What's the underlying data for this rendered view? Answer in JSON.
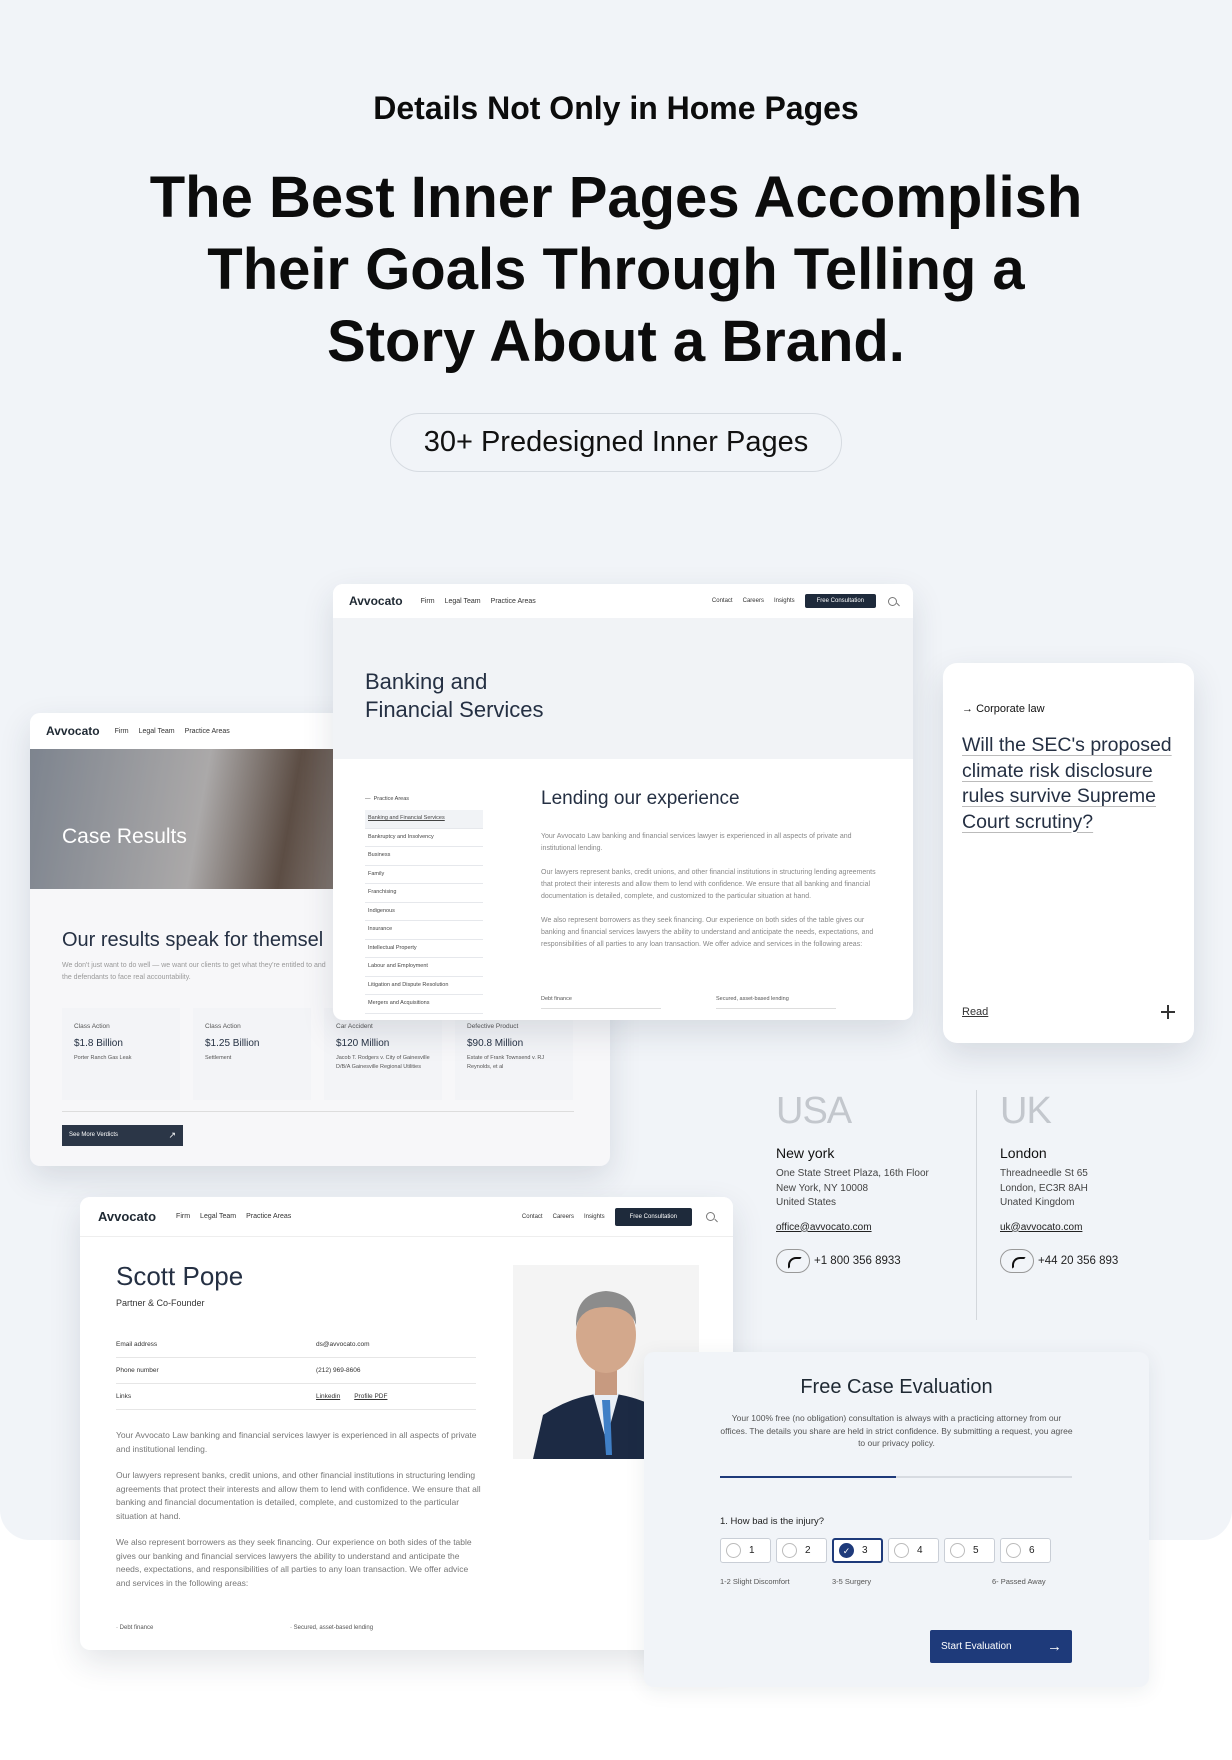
{
  "hero": {
    "kicker": "Details Not Only in Home Pages",
    "headline_line1": "The Best Inner Pages Accomplish",
    "headline_line2": "Their Goals Through Telling a",
    "headline_line3": "Story About a Brand.",
    "pill": "30+ Predesigned Inner Pages"
  },
  "nav": {
    "logo": "Avvocato",
    "firm": "Firm",
    "legal_team": "Legal Team",
    "practice_areas": "Practice Areas",
    "contact": "Contact",
    "careers": "Careers",
    "insights": "Insights",
    "cta": "Free Consultation"
  },
  "case_results": {
    "hero_title": "Case Results",
    "heading": "Our results speak for themsel",
    "intro": "We don't just want to do well — we want our clients to get what they're entitled to and the defendants to face real accountability.",
    "stats": [
      {
        "category": "Class Action",
        "value": "$1.8 Billion",
        "desc": "Porter Ranch Gas Leak"
      },
      {
        "category": "Class Action",
        "value": "$1.25 Billion",
        "desc": "Settlement"
      },
      {
        "category": "Car Accident",
        "value": "$120 Million",
        "desc": "Jacob T. Rodgers v. City of Gainesville D/B/A Gainesville Regional Utilities"
      },
      {
        "category": "Defective Product",
        "value": "$90.8 Million",
        "desc": "Estate of Frank Townsend v. RJ Reynolds, et al"
      }
    ],
    "button": "See More Verdicts"
  },
  "banking": {
    "title_line1": "Banking and",
    "title_line2": "Financial Services",
    "sidebar_heading": "Practice Areas",
    "sidebar_items": [
      "Banking and Financial Services",
      "Bankruptcy and Insolvency",
      "Business",
      "Family",
      "Franchising",
      "Indigenous",
      "Insurance",
      "Intellectual Property",
      "Labour and Employment",
      "Litigation and Dispute Resolution",
      "Mergers and Acquisitions"
    ],
    "section_title": "Lending our experience",
    "p1": "Your Avvocato Law banking and financial services lawyer is experienced in all aspects of private and institutional lending.",
    "p2": "Our lawyers represent banks, credit unions, and other financial institutions in structuring lending agreements that protect their interests and allow them to lend with confidence. We ensure that all banking and financial documentation is detailed, complete, and customized to the particular situation at hand.",
    "p3": "We also represent borrowers as they seek financing. Our experience on both sides of the table gives our banking and financial services lawyers the ability to understand and anticipate the needs, expectations, and responsibilities of all parties to any loan transaction. We offer advice and services in the following areas:",
    "list_left": "Debt finance",
    "list_right": "Secured, asset-based lending"
  },
  "article": {
    "category": "Corporate law",
    "title": "Will the SEC's proposed climate risk disclosure rules survive Supreme Court scrutiny?",
    "read": "Read"
  },
  "offices": [
    {
      "country": "USA",
      "city": "New york",
      "addr1": "One State Street Plaza, 16th Floor",
      "addr2": "New York, NY 10008",
      "addr3": "United States",
      "email": "office@avvocato.com",
      "phone": "+1 800 356 8933"
    },
    {
      "country": "UK",
      "city": "London",
      "addr1": "Threadneedle St 65",
      "addr2": "London, EC3R 8AH",
      "addr3": "Unated Kingdom",
      "email": "uk@avvocato.com",
      "phone": "+44 20 356 893"
    }
  ],
  "profile": {
    "name": "Scott Pope",
    "role": "Partner & Co-Founder",
    "rows": [
      {
        "label": "Email address",
        "value": "ds@avvocato.com"
      },
      {
        "label": "Phone number",
        "value": "(212) 969-8606"
      },
      {
        "label": "Links",
        "value": "Linkedin",
        "value2": "Profile PDF"
      }
    ],
    "p1": "Your Avvocato Law banking and financial services lawyer is experienced in all aspects of private and institutional lending.",
    "p2": "Our lawyers represent banks, credit unions, and other financial institutions in structuring lending agreements that protect their interests and allow them to lend with confidence. We ensure that all banking and financial documentation is detailed, complete, and customized to the particular situation at hand.",
    "p3": "We also represent borrowers as they seek financing. Our experience on both sides of the table gives our banking and financial services lawyers the ability to understand and anticipate the needs, expectations, and responsibilities of all parties to any loan transaction. We offer advice and services in the following areas:",
    "list_left": "Debt finance",
    "list_right": "Secured, asset-based lending"
  },
  "evaluation": {
    "title": "Free Case Evaluation",
    "description": "Your 100% free (no obligation) consultation is always with a practicing attorney from our offices. The details you share are held in strict confidence. By submitting a request, you agree to our privacy policy.",
    "progress": 0.5,
    "question": "1. How bad is the injury?",
    "options": [
      "1",
      "2",
      "3",
      "4",
      "5",
      "6"
    ],
    "selected": "3",
    "legend_low": "1-2 Slight Discomfort",
    "legend_mid": "3-5 Surgery",
    "legend_high": "6- Passed Away",
    "button": "Start Evaluation"
  },
  "colors": {
    "navy": "#1e3a7a",
    "dark": "#1e2a3b",
    "page_bg": "#f1f4f8"
  }
}
